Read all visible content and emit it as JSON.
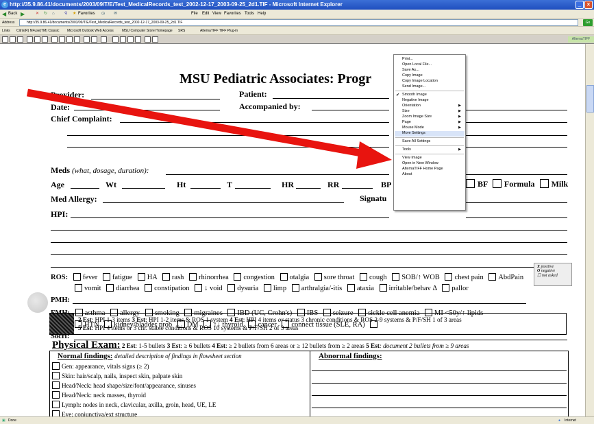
{
  "window": {
    "title": "http://35.9.86.41/documents/2003/09/T/E/Test_MedicalRecords_test_2002-12-17_2003-09-25_2d1.TIF - Microsoft Internet Explorer"
  },
  "nav": {
    "back": "Back",
    "favorites": "Favorites",
    "menu": [
      "File",
      "Edit",
      "View",
      "Favorites",
      "Tools",
      "Help"
    ]
  },
  "address": {
    "label": "Address",
    "url": "http://35.9.86.41/documents/2003/09/T/E/Test_MedicalRecords_test_2002-12-17_2003-09-25_2d1.TIF",
    "go": "Go"
  },
  "links": {
    "label": "Links",
    "items": [
      "Citrix(R) NFuse(TM) Classic",
      "Microsoft Outlook Web Access",
      "MSU Computer Store Homepage",
      "SRS",
      "AlternaTIFF TIFF Plug-in"
    ]
  },
  "tiff_toolbar": {
    "alt_label": "AlternaTIFF"
  },
  "form": {
    "title": "MSU Pediatric Associates: Progr",
    "provider": "Provider:",
    "patient": "Patient:",
    "date": "Date:",
    "accompanied": "Accompanied by:",
    "chief": "Chief Complaint:",
    "meds": "Meds",
    "meds_hint": "(what, dosage, duration):",
    "vitals": [
      "Age",
      "Wt",
      "Ht",
      "T",
      "HR",
      "RR",
      "BP"
    ],
    "feeding": [
      "BF",
      "Formula",
      "Milk"
    ],
    "med_allergy": "Med Allergy:",
    "signature": "Signatu",
    "hpi": "HPI:",
    "ros_label": "ROS:",
    "ros_row1": [
      "fever",
      "fatigue",
      "HA",
      "rash",
      "rhinorrhea",
      "congestion",
      "otalgia",
      "sore throat",
      "cough",
      "SOB/↑ WOB",
      "chest pain",
      "AbdPain"
    ],
    "ros_row2": [
      "vomit",
      "diarrhea",
      "constipation",
      "↓ void",
      "dysuria",
      "limp",
      "arthralgia/-itis",
      "ataxia",
      "irritable/behav Δ",
      "pallor"
    ],
    "pmh": "PMH:",
    "fmh_label": "FMH:",
    "fmh_row1": [
      "asthma",
      "allergy",
      "smoking",
      "migraines",
      "IBD (UC, Crohn's)",
      "IBS",
      "seizure",
      "sickle cell anemia",
      "MI <50y/↑ lipids"
    ],
    "fmh_row2": [
      "HTN",
      "kidney/bladder prob",
      "DM",
      "↑↓ thyroid",
      "cancer",
      "connect tissue (SLE, RA)"
    ],
    "soch": "SocH:",
    "legend": [
      "positive",
      "negative",
      "not asked"
    ],
    "est_line1_a": "2 Est",
    "est_line1_b": ": HPI 1-3 items",
    "est_line1_c": "3 Est",
    "est_line1_d": ": HPI 1-2 items & ROS 1 system",
    "est_line1_e": "4 Est",
    "est_line1_f": ": HPI 4 items",
    "est_line1_g": " or ",
    "est_line1_h": "status 3 chronic conditions & ROS 2-9 systems & P/F/SH 1 of 3 areas",
    "est_line2_a": "5 Est",
    "est_line2_b": ": HPI 4 items or 3 chr. stable conditions & ROS 10 systems & P/F/SH 2 of 3 areas",
    "pe_title": "Physical Exam:",
    "pe_rules": [
      {
        "k": "2 Est",
        "v": ": 1-5 bullets"
      },
      {
        "k": "3 Est",
        "v": ": ≥ 6 bullets"
      },
      {
        "k": "4 Est",
        "v": ": ≥ 2 bullets from 6 areas or ≥ 12 bullets from ≥ 2 areas"
      },
      {
        "k": "5 Est",
        "v": ": document 2 bullets from ≥ 9 areas"
      }
    ],
    "normal_title": "Normal findings:",
    "normal_hint": "detailed description of findings in flowsheet section",
    "abnormal_title": "Abnormal findings:",
    "findings": [
      "Gen: appearance, vitals signs (≥ 2)",
      "Skin: hair/scalp, nails, inspect skin, palpate skin",
      "Head/Neck: head shape/size/font/appearance, sinuses",
      "Head/Neck: neck masses, thyroid",
      "Lymph: nodes in neck, clavicular, axilla, groin, head, UE, LE",
      "Eye: conjunctiva/ext structure"
    ]
  },
  "context_menu": {
    "items": [
      {
        "label": "Print..."
      },
      {
        "label": "Open Local File..."
      },
      {
        "label": "Save As..."
      },
      {
        "label": "Copy Image"
      },
      {
        "label": "Copy Image Location"
      },
      {
        "label": "Send Image..."
      },
      {
        "label": "Smooth Image",
        "checked": true
      },
      {
        "label": "Negative Image"
      },
      {
        "label": "Orientation",
        "submenu": true
      },
      {
        "label": "Size",
        "submenu": true
      },
      {
        "label": "Zoom Image Size",
        "submenu": true
      },
      {
        "label": "Page",
        "submenu": true
      },
      {
        "label": "Mouse Mode",
        "submenu": true
      },
      {
        "label": "More Settings",
        "highlighted": true
      },
      {
        "label": "Save All Settings"
      },
      {
        "label": "Tools",
        "submenu": true
      },
      {
        "label": "View Image"
      },
      {
        "label": "Open in New Window"
      },
      {
        "label": "AlternaTIFF Home Page"
      },
      {
        "label": "About"
      }
    ]
  },
  "status": {
    "left": "Done",
    "right": "Internet"
  },
  "colors": {
    "arrow": "#e8140f",
    "titlebar": "#2457c8",
    "menu_highlight": "#d8e4f8"
  }
}
